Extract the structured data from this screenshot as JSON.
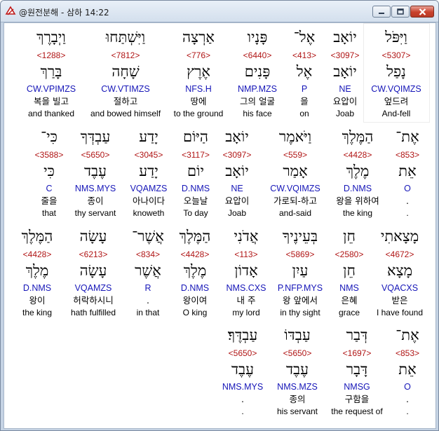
{
  "window": {
    "title": "@원전분해 - 삼하 14:22"
  },
  "rows": [
    {
      "cells": [
        {
          "hebrew": "וַיִּפֹּל",
          "strong": "<5307>",
          "lexeme": "נָפַל",
          "morph": "CW.VQIMZS",
          "korean": "엎드려",
          "english": "And-fell"
        },
        {
          "hebrew": "יוֹאָב",
          "strong": "<3097>",
          "lexeme": "יוֹאָב",
          "morph": "NE",
          "korean": "요압이",
          "english": "Joab"
        },
        {
          "hebrew": "אֶל־",
          "strong": "<413>",
          "lexeme": "אֶל",
          "morph": "P",
          "korean": "을",
          "english": "on"
        },
        {
          "hebrew": "פָּנָיו",
          "strong": "<6440>",
          "lexeme": "פָּנִים",
          "morph": "NMP.MZS",
          "korean": "그의 얼굴",
          "english": "his face"
        },
        {
          "hebrew": "אַרְצָה",
          "strong": "<776>",
          "lexeme": "אֶרֶץ",
          "morph": "NFS.H",
          "korean": "땅에",
          "english": "to the ground"
        },
        {
          "hebrew": "וַיִּשְׁתַּחוּ",
          "strong": "<7812>",
          "lexeme": "שָׁחָה",
          "morph": "CW.VTIMZS",
          "korean": "절하고",
          "english": "and bowed himself"
        },
        {
          "hebrew": "וַיְבָרֶךְ",
          "strong": "<1288>",
          "lexeme": "בָּרַךְ",
          "morph": "CW.VPIMZS",
          "korean": "복을 빌고",
          "english": "and thanked"
        }
      ]
    },
    {
      "cells": [
        {
          "hebrew": "אֶת־",
          "strong": "<853>",
          "lexeme": "אֵת",
          "morph": "O",
          "korean": ".",
          "english": "."
        },
        {
          "hebrew": "הַמֶּלֶךְ",
          "strong": "<4428>",
          "lexeme": "מֶלֶךְ",
          "morph": "D.NMS",
          "korean": "왕을 위하여",
          "english": "the king"
        },
        {
          "hebrew": "וַיֹּאמֶר",
          "strong": "<559>",
          "lexeme": "אָמַר",
          "morph": "CW.VQIMZS",
          "korean": "가로되-하고",
          "english": "and-said"
        },
        {
          "hebrew": "יוֹאָב",
          "strong": "<3097>",
          "lexeme": "יוֹאָב",
          "morph": "NE",
          "korean": "요압이",
          "english": "Joab"
        },
        {
          "hebrew": "הַיּוֹם",
          "strong": "<3117>",
          "lexeme": "יוֹם",
          "morph": "D.NMS",
          "korean": "오늘날",
          "english": "To day"
        },
        {
          "hebrew": "יָדַע",
          "strong": "<3045>",
          "lexeme": "יָדַע",
          "morph": "VQAMZS",
          "korean": "아나이다",
          "english": "knoweth"
        },
        {
          "hebrew": "עַבְדְּךָ",
          "strong": "<5650>",
          "lexeme": "עֶבֶד",
          "morph": "NMS.MYS",
          "korean": "종이",
          "english": "thy servant"
        },
        {
          "hebrew": "כִּי־",
          "strong": "<3588>",
          "lexeme": "כִּי",
          "morph": "C",
          "korean": "줄을",
          "english": "that"
        }
      ]
    },
    {
      "cells": [
        {
          "hebrew": "מָצָאתִי",
          "strong": "<4672>",
          "lexeme": "מָצָא",
          "morph": "VQACXS",
          "korean": "받은",
          "english": "I have found"
        },
        {
          "hebrew": "חֵן",
          "strong": "<2580>",
          "lexeme": "חֵן",
          "morph": "NMS",
          "korean": "은혜",
          "english": "grace"
        },
        {
          "hebrew": "בְּעֵינֶיךָ",
          "strong": "<5869>",
          "lexeme": "עַיִן",
          "morph": "P.NFP.MYS",
          "korean": "왕 앞에서",
          "english": "in thy sight"
        },
        {
          "hebrew": "אֲדֹנִי",
          "strong": "<113>",
          "lexeme": "אָדוֹן",
          "morph": "NMS.CXS",
          "korean": "내 주",
          "english": "my lord"
        },
        {
          "hebrew": "הַמֶּלֶךְ",
          "strong": "<4428>",
          "lexeme": "מֶלֶךְ",
          "morph": "D.NMS",
          "korean": "왕이여",
          "english": "O king"
        },
        {
          "hebrew": "אֲשֶׁר־",
          "strong": "<834>",
          "lexeme": "אֲשֶׁר",
          "morph": "R",
          "korean": ".",
          "english": "in that"
        },
        {
          "hebrew": "עָשָׂה",
          "strong": "<6213>",
          "lexeme": "עָשָׂה",
          "morph": "VQAMZS",
          "korean": "허락하시니",
          "english": "hath fulfilled"
        },
        {
          "hebrew": "הַמֶּלֶךְ",
          "strong": "<4428>",
          "lexeme": "מֶלֶךְ",
          "morph": "D.NMS",
          "korean": "왕이",
          "english": "the king"
        }
      ]
    },
    {
      "cells": [
        {
          "hebrew": "אֶת־",
          "strong": "<853>",
          "lexeme": "אֵת",
          "morph": "O",
          "korean": ".",
          "english": "."
        },
        {
          "hebrew": "דְּבַר",
          "strong": "<1697>",
          "lexeme": "דָּבָר",
          "morph": "NMSG",
          "korean": "구함을",
          "english": "the request of"
        },
        {
          "hebrew": "עַבְדּוֹ",
          "strong": "<5650>",
          "lexeme": "עֶבֶד",
          "morph": "NMS.MZS",
          "korean": "종의",
          "english": "his servant"
        },
        {
          "hebrew": "עַבְדֶּךָ׃",
          "strong": "<5650>",
          "lexeme": "עֶבֶד",
          "morph": "NMS.MYS",
          "korean": ".",
          "english": "."
        }
      ]
    }
  ]
}
